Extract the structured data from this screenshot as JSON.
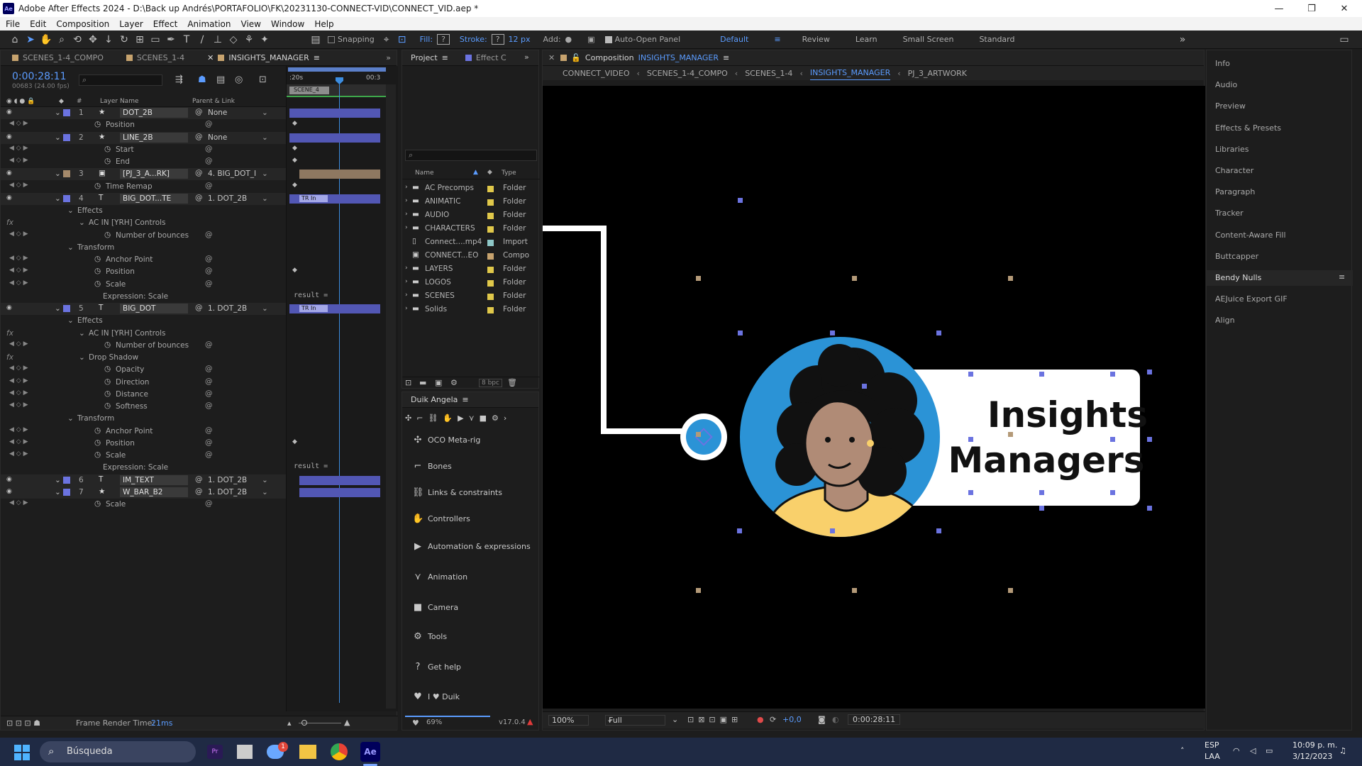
{
  "window": {
    "title": "Adobe After Effects 2024 - D:\\Back up Andrés\\PORTAFOLIO\\FK\\20231130-CONNECT-VID\\CONNECT_VID.aep *",
    "logo": "Ae"
  },
  "menu": [
    "File",
    "Edit",
    "Composition",
    "Layer",
    "Effect",
    "Animation",
    "View",
    "Window",
    "Help"
  ],
  "toolbar": {
    "snapping": "Snapping",
    "fill": "Fill:",
    "fill_value": "?",
    "stroke": "Stroke:",
    "stroke_value": "?",
    "stroke_width": "12 px",
    "add": "Add:",
    "auto_open": "Auto-Open Panel"
  },
  "workspaces": [
    "Default",
    "Review",
    "Learn",
    "Small Screen",
    "Standard"
  ],
  "timeline": {
    "tabs": [
      "SCENES_1-4_COMPO",
      "SCENES_1-4",
      "INSIGHTS_MANAGER"
    ],
    "tab_colors": [
      "#c7a36e",
      "#c7a36e",
      "#c7a36e"
    ],
    "timecode": "0:00:28:11",
    "frames": "00683 (24.00 fps)",
    "col_layer": "Layer Name",
    "col_parent": "Parent & Link",
    "col_num": "#",
    "ruler_start": ":20s",
    "ruler_end": "00:3",
    "work_label": "SCENE_4",
    "render_label": "Frame Render Time:",
    "render_value": "21ms",
    "rows": [
      {
        "type": "layer",
        "num": "1",
        "name": "DOT_2B",
        "parent": "None",
        "color": "#6b73e0",
        "icon": "star-icon"
      },
      {
        "type": "prop",
        "name": "Position",
        "indent": 1
      },
      {
        "type": "layer",
        "num": "2",
        "name": "LINE_2B",
        "parent": "None",
        "color": "#6b73e0",
        "icon": "star-icon"
      },
      {
        "type": "prop",
        "name": "Start",
        "indent": 2
      },
      {
        "type": "prop",
        "name": "End",
        "indent": 2
      },
      {
        "type": "layer",
        "num": "3",
        "name": "[PJ_3_A...RK]",
        "parent": "4. BIG_DOT_I",
        "color": "#a58a6b",
        "icon": "comp-icon"
      },
      {
        "type": "prop",
        "name": "Time Remap",
        "indent": 1
      },
      {
        "type": "layer",
        "num": "4",
        "name": "BIG_DOT...TE",
        "parent": "1. DOT_2B",
        "color": "#6b73e0",
        "icon": "text-icon"
      },
      {
        "type": "group",
        "name": "Effects",
        "indent": 0
      },
      {
        "type": "group",
        "name": "AC IN [YRH] Controls",
        "indent": 1,
        "fx": "fx"
      },
      {
        "type": "prop",
        "name": "Number of bounces",
        "indent": 2
      },
      {
        "type": "group",
        "name": "Transform",
        "indent": 0
      },
      {
        "type": "prop",
        "name": "Anchor Point",
        "indent": 1
      },
      {
        "type": "prop",
        "name": "Position",
        "indent": 1
      },
      {
        "type": "prop",
        "name": "Scale",
        "indent": 1
      },
      {
        "type": "expr",
        "name": "Expression: Scale",
        "result": "result ="
      },
      {
        "type": "layer",
        "num": "5",
        "name": "BIG_DOT",
        "parent": "1. DOT_2B",
        "color": "#6b73e0",
        "icon": "text-icon"
      },
      {
        "type": "group",
        "name": "Effects",
        "indent": 0
      },
      {
        "type": "group",
        "name": "AC IN [YRH] Controls",
        "indent": 1,
        "fx": "fx"
      },
      {
        "type": "prop",
        "name": "Number of bounces",
        "indent": 2
      },
      {
        "type": "group",
        "name": "Drop Shadow",
        "indent": 1,
        "fx": "fx"
      },
      {
        "type": "prop",
        "name": "Opacity",
        "indent": 2
      },
      {
        "type": "prop",
        "name": "Direction",
        "indent": 2
      },
      {
        "type": "prop",
        "name": "Distance",
        "indent": 2
      },
      {
        "type": "prop",
        "name": "Softness",
        "indent": 2
      },
      {
        "type": "group",
        "name": "Transform",
        "indent": 0
      },
      {
        "type": "prop",
        "name": "Anchor Point",
        "indent": 1
      },
      {
        "type": "prop",
        "name": "Position",
        "indent": 1
      },
      {
        "type": "prop",
        "name": "Scale",
        "indent": 1
      },
      {
        "type": "expr",
        "name": "Expression: Scale",
        "result": "result ="
      },
      {
        "type": "layer",
        "num": "6",
        "name": "IM_TEXT",
        "parent": "1. DOT_2B",
        "color": "#6b73e0",
        "icon": "text-icon"
      },
      {
        "type": "layer",
        "num": "7",
        "name": "W_BAR_B2",
        "parent": "1. DOT_2B",
        "color": "#6b73e0",
        "icon": "star-icon"
      },
      {
        "type": "prop",
        "name": "Scale",
        "indent": 1
      }
    ],
    "tr_in": "TR In"
  },
  "project": {
    "tabs": [
      "Project",
      "Effect C"
    ],
    "col_name": "Name",
    "col_type": "Type",
    "bpc": "8 bpc",
    "items": [
      {
        "name": "AC Precomps",
        "type": "Folder",
        "color": "#e0c84a",
        "icon": "folder-icon"
      },
      {
        "name": "ANIMATIC",
        "type": "Folder",
        "color": "#e0c84a",
        "icon": "folder-icon"
      },
      {
        "name": "AUDIO",
        "type": "Folder",
        "color": "#e0c84a",
        "icon": "folder-icon"
      },
      {
        "name": "CHARACTERS",
        "type": "Folder",
        "color": "#e0c84a",
        "icon": "folder-icon"
      },
      {
        "name": "Connect....mp4",
        "type": "Import",
        "color": "#8ec7c7",
        "icon": "file-icon"
      },
      {
        "name": "CONNECT...EO",
        "type": "Compo",
        "color": "#c7a36e",
        "icon": "comp-icon"
      },
      {
        "name": "LAYERS",
        "type": "Folder",
        "color": "#e0c84a",
        "icon": "folder-icon"
      },
      {
        "name": "LOGOS",
        "type": "Folder",
        "color": "#e0c84a",
        "icon": "folder-icon"
      },
      {
        "name": "SCENES",
        "type": "Folder",
        "color": "#e0c84a",
        "icon": "folder-icon"
      },
      {
        "name": "Solids",
        "type": "Folder",
        "color": "#e0c84a",
        "icon": "folder-icon"
      }
    ]
  },
  "duik": {
    "title": "Duik Angela",
    "items": [
      {
        "label": "OCO Meta-rig",
        "icon": "meta-rig-icon",
        "glyph": "✣"
      },
      {
        "label": "Bones",
        "icon": "bone-icon",
        "glyph": "⌐"
      },
      {
        "label": "Links & constraints",
        "icon": "link-icon",
        "glyph": "⛓"
      },
      {
        "label": "Controllers",
        "icon": "hand-icon",
        "glyph": "✋"
      },
      {
        "label": "Automation & expressions",
        "icon": "play-icon",
        "glyph": "▶"
      },
      {
        "label": "Animation",
        "icon": "animation-icon",
        "glyph": "⋎"
      },
      {
        "label": "Camera",
        "icon": "camera-icon",
        "glyph": "■"
      },
      {
        "label": "Tools",
        "icon": "tools-icon",
        "glyph": "⚙"
      },
      {
        "label": "Get help",
        "icon": "help-icon",
        "glyph": "?"
      },
      {
        "label": "I ♥ Duik",
        "icon": "heart-icon",
        "glyph": "♥"
      }
    ],
    "progress": "69%",
    "version": "v17.0.4"
  },
  "composition": {
    "label": "Composition",
    "name": "INSIGHTS_MANAGER",
    "breadcrumbs": [
      "CONNECT_VIDEO",
      "SCENES_1-4_COMPO",
      "SCENES_1-4",
      "INSIGHTS_MANAGER",
      "PJ_3_ARTWORK"
    ],
    "card_line1": "Insights",
    "card_line2": "Managers",
    "zoom": "100%",
    "resolution": "Full",
    "exposure": "+0,0",
    "timecode": "0:00:28:11"
  },
  "right_panel": [
    "Info",
    "Audio",
    "Preview",
    "Effects & Presets",
    "Libraries",
    "Character",
    "Paragraph",
    "Tracker",
    "Content-Aware Fill",
    "Buttcapper",
    "Bendy Nulls",
    "AEJuice Export GIF",
    "Align"
  ],
  "taskbar": {
    "search": "Búsqueda",
    "lang1": "ESP",
    "lang2": "LAA",
    "time": "10:09 p. m.",
    "date": "3/12/2023",
    "badge": "1"
  }
}
